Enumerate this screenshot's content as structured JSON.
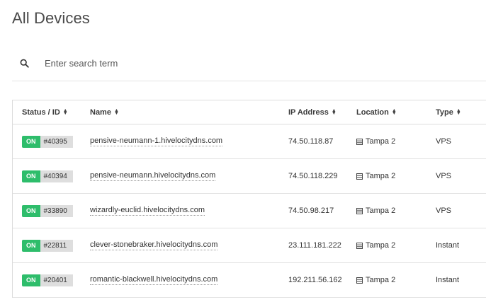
{
  "page": {
    "title": "All Devices"
  },
  "search": {
    "placeholder": "Enter search term",
    "value": ""
  },
  "table": {
    "columns": {
      "status": "Status / ID",
      "name": "Name",
      "ip": "IP Address",
      "location": "Location",
      "type": "Type"
    },
    "rows": [
      {
        "status": "ON",
        "id": "#40395",
        "name": "pensive-neumann-1.hivelocitydns.com",
        "ip": "74.50.118.87",
        "location": "Tampa 2",
        "type": "VPS"
      },
      {
        "status": "ON",
        "id": "#40394",
        "name": "pensive-neumann.hivelocitydns.com",
        "ip": "74.50.118.229",
        "location": "Tampa 2",
        "type": "VPS"
      },
      {
        "status": "ON",
        "id": "#33890",
        "name": "wizardly-euclid.hivelocitydns.com",
        "ip": "74.50.98.217",
        "location": "Tampa 2",
        "type": "VPS"
      },
      {
        "status": "ON",
        "id": "#22811",
        "name": "clever-stonebraker.hivelocitydns.com",
        "ip": "23.111.181.222",
        "location": "Tampa 2",
        "type": "Instant"
      },
      {
        "status": "ON",
        "id": "#20401",
        "name": "romantic-blackwell.hivelocitydns.com",
        "ip": "192.211.56.162",
        "location": "Tampa 2",
        "type": "Instant"
      }
    ]
  },
  "colors": {
    "status_on": "#2ebd6b",
    "id_badge_bg": "#dedede"
  },
  "icons": {
    "search": "search-icon",
    "sort": "sort-icon",
    "server": "server-icon"
  }
}
